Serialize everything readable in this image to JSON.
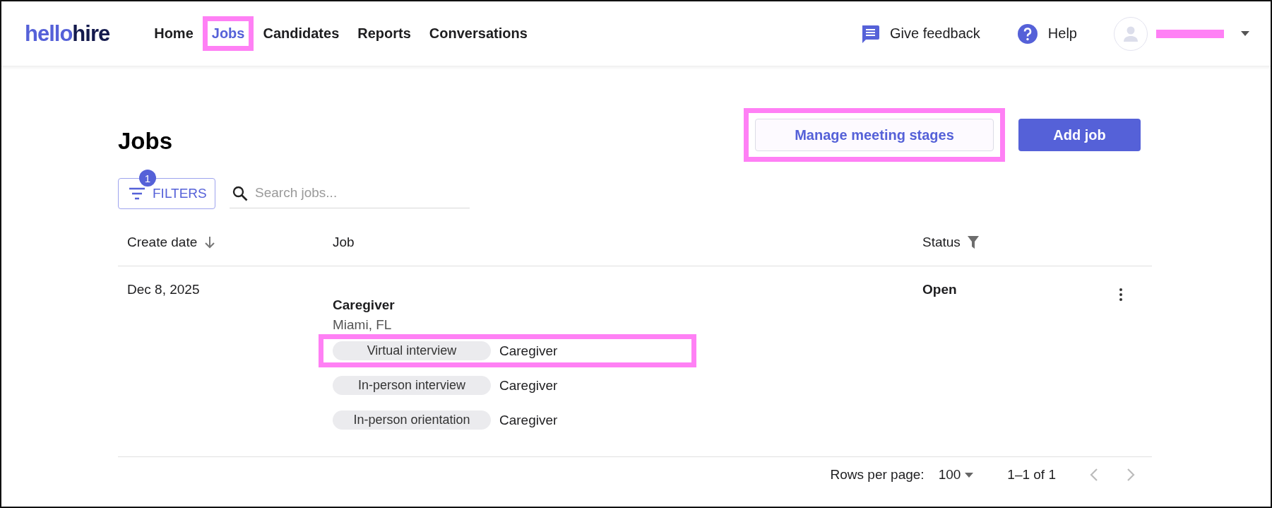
{
  "header": {
    "logo": {
      "part_1": "hello",
      "part_2": "hire"
    },
    "nav": [
      {
        "label": "Home",
        "selected": false,
        "highlighted": false
      },
      {
        "label": "Jobs",
        "selected": true,
        "highlighted": true
      },
      {
        "label": "Candidates",
        "selected": false,
        "highlighted": false
      },
      {
        "label": "Reports",
        "selected": false,
        "highlighted": false
      },
      {
        "label": "Conversations",
        "selected": false,
        "highlighted": false
      }
    ],
    "feedback": "Give feedback",
    "help": "Help"
  },
  "page": {
    "title": "Jobs",
    "buttons": [
      {
        "label": "Manage meeting stages",
        "kind": "outlined",
        "highlighted": true
      },
      {
        "label": "Add job",
        "kind": "filled",
        "highlighted": false
      }
    ],
    "filters": {
      "label": "FILTERS",
      "count": "1"
    },
    "search": {
      "placeholder": "Search jobs..."
    },
    "table": {
      "columns": [
        "Create date",
        "Job",
        "Status"
      ],
      "rows": [
        {
          "date": "Dec 8, 2025",
          "job": "Caregiver",
          "location": "Miami, FL",
          "status": "Open",
          "meetings": [
            {
              "stage": "Virtual interview",
              "role": "Caregiver",
              "highlighted": true
            },
            {
              "stage": "In-person interview",
              "role": "Caregiver",
              "highlighted": false
            },
            {
              "stage": "In-person orientation",
              "role": "Caregiver",
              "highlighted": false
            }
          ]
        }
      ]
    },
    "pagination": {
      "rows_label": "Rows per page:",
      "rows_value": "100",
      "range": "1–1 of 1"
    }
  }
}
